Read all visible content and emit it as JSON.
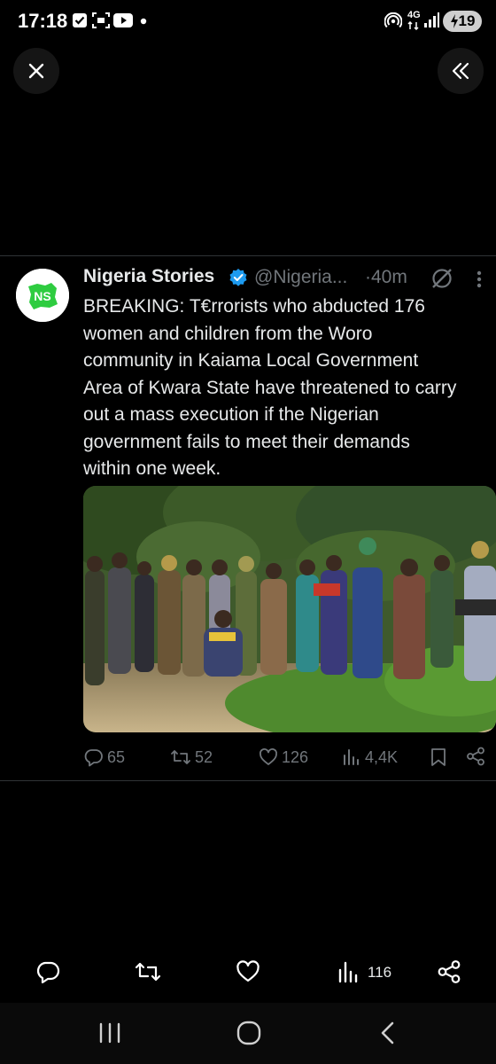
{
  "status_bar": {
    "time": "17:18",
    "network": "4G",
    "battery": "19"
  },
  "tweet": {
    "display_name": "Nigeria Stories",
    "handle": "@Nigeria...",
    "time": "·40m",
    "avatar_text": "NS",
    "text": "BREAKING: T€rrorists who abducted 176\nwomen and children from the Woro\ncommunity in Kaiama Local Government\nArea of Kwara State have threatened to carry\nout a mass execution if the Nigerian\ngovernment fails to meet their demands\nwithin one week.",
    "replies": "65",
    "reposts": "52",
    "likes": "126",
    "views": "4,4K"
  },
  "bottom_bar": {
    "view_count": "116"
  },
  "colors": {
    "background": "#000000",
    "text": "#e7e9ea",
    "secondary": "#71767b",
    "verified": "#1d9bf0",
    "avatar_green": "#2ecc40"
  },
  "icons": [
    "close-icon",
    "collapse-icon",
    "verified-badge-icon",
    "grok-icon",
    "more-icon",
    "reply-icon",
    "repost-icon",
    "like-icon",
    "views-icon",
    "bookmark-icon",
    "share-icon",
    "recents-icon",
    "home-icon",
    "back-icon"
  ]
}
